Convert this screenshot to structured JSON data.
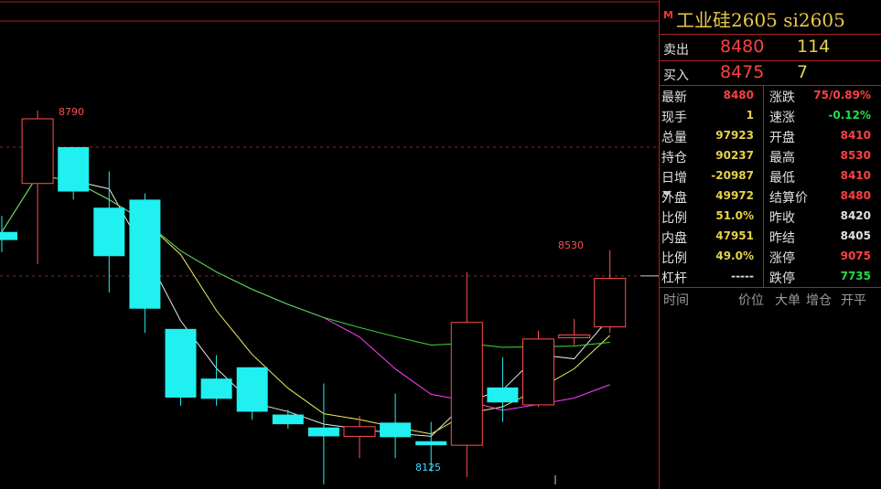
{
  "chart_data": {
    "type": "candlestick",
    "high_label": "8790",
    "low_label": "8125",
    "last_label": "8530",
    "candles": [
      {
        "o": 8560,
        "c": 8580,
        "h": 8620,
        "l": 8530,
        "up": false
      },
      {
        "o": 8700,
        "c": 8860,
        "h": 8880,
        "l": 8500,
        "up": true
      },
      {
        "o": 8790,
        "c": 8680,
        "h": 8790,
        "l": 8660,
        "up": false
      },
      {
        "o": 8640,
        "c": 8520,
        "h": 8730,
        "l": 8430,
        "up": false
      },
      {
        "o": 8660,
        "c": 8390,
        "h": 8675,
        "l": 8330,
        "up": false
      },
      {
        "o": 8340,
        "c": 8170,
        "h": 8340,
        "l": 8150,
        "up": false
      },
      {
        "o": 8217,
        "c": 8167,
        "h": 8275,
        "l": 8150,
        "up": false
      },
      {
        "o": 8245,
        "c": 8135,
        "h": 8245,
        "l": 8115,
        "up": false
      },
      {
        "o": 8128,
        "c": 8104,
        "h": 8140,
        "l": 8093,
        "up": false
      },
      {
        "o": 8096,
        "c": 8074,
        "h": 8205,
        "l": 7955,
        "up": false
      },
      {
        "o": 8074,
        "c": 8098,
        "h": 8125,
        "l": 8020,
        "up": true
      },
      {
        "o": 8108,
        "c": 8072,
        "h": 8180,
        "l": 8020,
        "up": false
      },
      {
        "o": 8062,
        "c": 8052,
        "h": 8110,
        "l": 7987,
        "up": false
      },
      {
        "o": 8052,
        "c": 8356,
        "h": 8480,
        "l": 7973,
        "up": true
      },
      {
        "o": 8195,
        "c": 8158,
        "h": 8270,
        "l": 8110,
        "up": false
      },
      {
        "o": 8152,
        "c": 8315,
        "h": 8335,
        "l": 8147,
        "up": true
      },
      {
        "o": 8318,
        "c": 8325,
        "h": 8365,
        "l": 8300,
        "up": true
      },
      {
        "o": 8345,
        "c": 8465,
        "h": 8535,
        "l": 8330,
        "up": true
      }
    ]
  },
  "panel": {
    "mark": "M",
    "title": "工业硅2605 si2605",
    "sell_label": "卖出",
    "sell_price": "8480",
    "sell_vol": "114",
    "buy_label": "买入",
    "buy_price": "8475",
    "buy_vol": "7",
    "rows": [
      {
        "l1": "最新",
        "v1": "8480",
        "c1": "red",
        "l2": "涨跌",
        "v2": "75/0.89%",
        "c2": "red"
      },
      {
        "l1": "现手",
        "v1": "1",
        "c1": "yellow",
        "l2": "速涨",
        "v2": "-0.12%",
        "c2": "green"
      },
      {
        "l1": "总量",
        "v1": "97923",
        "c1": "yellow",
        "l2": "开盘",
        "v2": "8410",
        "c2": "red"
      },
      {
        "l1": "持仓",
        "v1": "90237",
        "c1": "yellow",
        "l2": "最高",
        "v2": "8530",
        "c2": "red"
      },
      {
        "l1": "日增",
        "v1": "-20987",
        "c1": "yellow",
        "l2": "最低",
        "v2": "8410",
        "c2": "red"
      },
      {
        "l1": "外盘",
        "v1": "49972",
        "c1": "yellow",
        "l2": "结算价",
        "v2": "8480",
        "c2": "red"
      },
      {
        "l1": "比例",
        "v1": "51.0%",
        "c1": "yellow",
        "l2": "昨收",
        "v2": "8420",
        "c2": "white"
      },
      {
        "l1": "内盘",
        "v1": "47951",
        "c1": "yellow",
        "l2": "昨结",
        "v2": "8405",
        "c2": "white"
      },
      {
        "l1": "比例",
        "v1": "49.0%",
        "c1": "yellow",
        "l2": "涨停",
        "v2": "9075",
        "c2": "red"
      },
      {
        "l1": "杠杆",
        "v1": "-----",
        "c1": "white",
        "l2": "跌停",
        "v2": "7735",
        "c2": "green"
      }
    ],
    "ticks_header": {
      "time": "时间",
      "price": "价位",
      "big": "大单",
      "oi": "增仓",
      "openclose": "开平"
    }
  }
}
